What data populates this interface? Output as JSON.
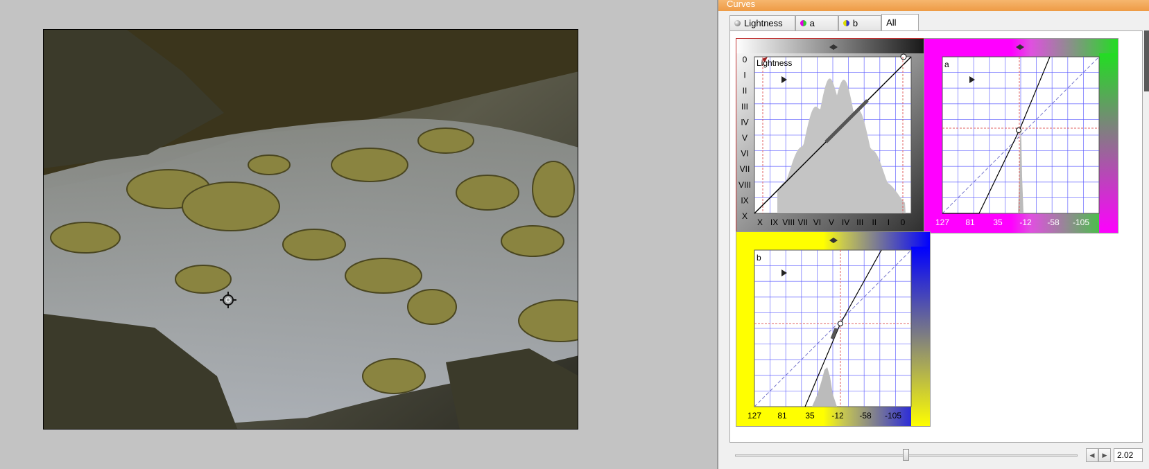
{
  "panel": {
    "title": "Curves"
  },
  "tabs": [
    {
      "label": "Lightness",
      "icon": "lightness-icon",
      "active": false
    },
    {
      "label": "a",
      "icon": "a-channel-icon",
      "active": false
    },
    {
      "label": "b",
      "icon": "b-channel-icon",
      "active": false
    },
    {
      "label": "All",
      "icon": "",
      "active": true
    }
  ],
  "lightness": {
    "label": "Lightness",
    "y_ticks": [
      "0",
      "I",
      "II",
      "III",
      "IV",
      "V",
      "VI",
      "VII",
      "VIII",
      "IX",
      "X"
    ],
    "x_ticks": [
      "X",
      "IX",
      "VIII",
      "VII",
      "VI",
      "V",
      "IV",
      "III",
      "II",
      "I",
      "0"
    ]
  },
  "a_channel": {
    "label": "a",
    "x_ticks": [
      "127",
      "81",
      "35",
      "-12",
      "-58",
      "-105"
    ]
  },
  "b_channel": {
    "label": "b",
    "x_ticks": [
      "127",
      "81",
      "35",
      "-12",
      "-58",
      "-105"
    ]
  },
  "slider": {
    "value": "2.02",
    "position": 0.5
  },
  "colors": {
    "grid": "#5b5bff",
    "accent_title": "#ee9b45",
    "a_minus": "#ff00ff",
    "a_plus": "#22dd22",
    "b_minus": "#ffff00",
    "b_plus": "#0000ff"
  }
}
